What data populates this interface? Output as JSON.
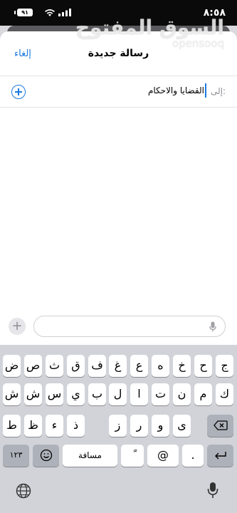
{
  "status_bar": {
    "time": "٨:٥٨",
    "battery": "٩١"
  },
  "watermark": {
    "arabic": "السوق المفتوح",
    "latin": "opensooq"
  },
  "header": {
    "cancel_label": "إلغاء",
    "title": "رسالة جديدة"
  },
  "recipient": {
    "to_label": "إلى:",
    "value": "القضايا والاحكام"
  },
  "keyboard": {
    "row1": [
      "ج",
      "ح",
      "خ",
      "ه",
      "ع",
      "غ",
      "ف",
      "ق",
      "ث",
      "ص",
      "ض"
    ],
    "row2": [
      "ك",
      "م",
      "ن",
      "ت",
      "ا",
      "ل",
      "ب",
      "ي",
      "س",
      "ش"
    ],
    "row3": [
      "ى",
      "و",
      "ر",
      "ز",
      "ذ",
      "ء",
      "ظ",
      "ط"
    ],
    "numbers_key": "١٢٣",
    "space_key": "مسافة",
    "at_key": "@",
    "tanween_key": "ً",
    "dot_key": "."
  },
  "colors": {
    "accent": "#1a7ae0",
    "sheet": "#ffffff",
    "keyboard": "#d1d3d9"
  },
  "icons": [
    "battery-icon",
    "wifi-icon",
    "cellular-signal-icon",
    "add-contact-icon",
    "attach-plus-icon",
    "dictation-mic-icon",
    "emoji-icon",
    "backspace-icon",
    "return-icon",
    "globe-icon",
    "mic-icon"
  ]
}
